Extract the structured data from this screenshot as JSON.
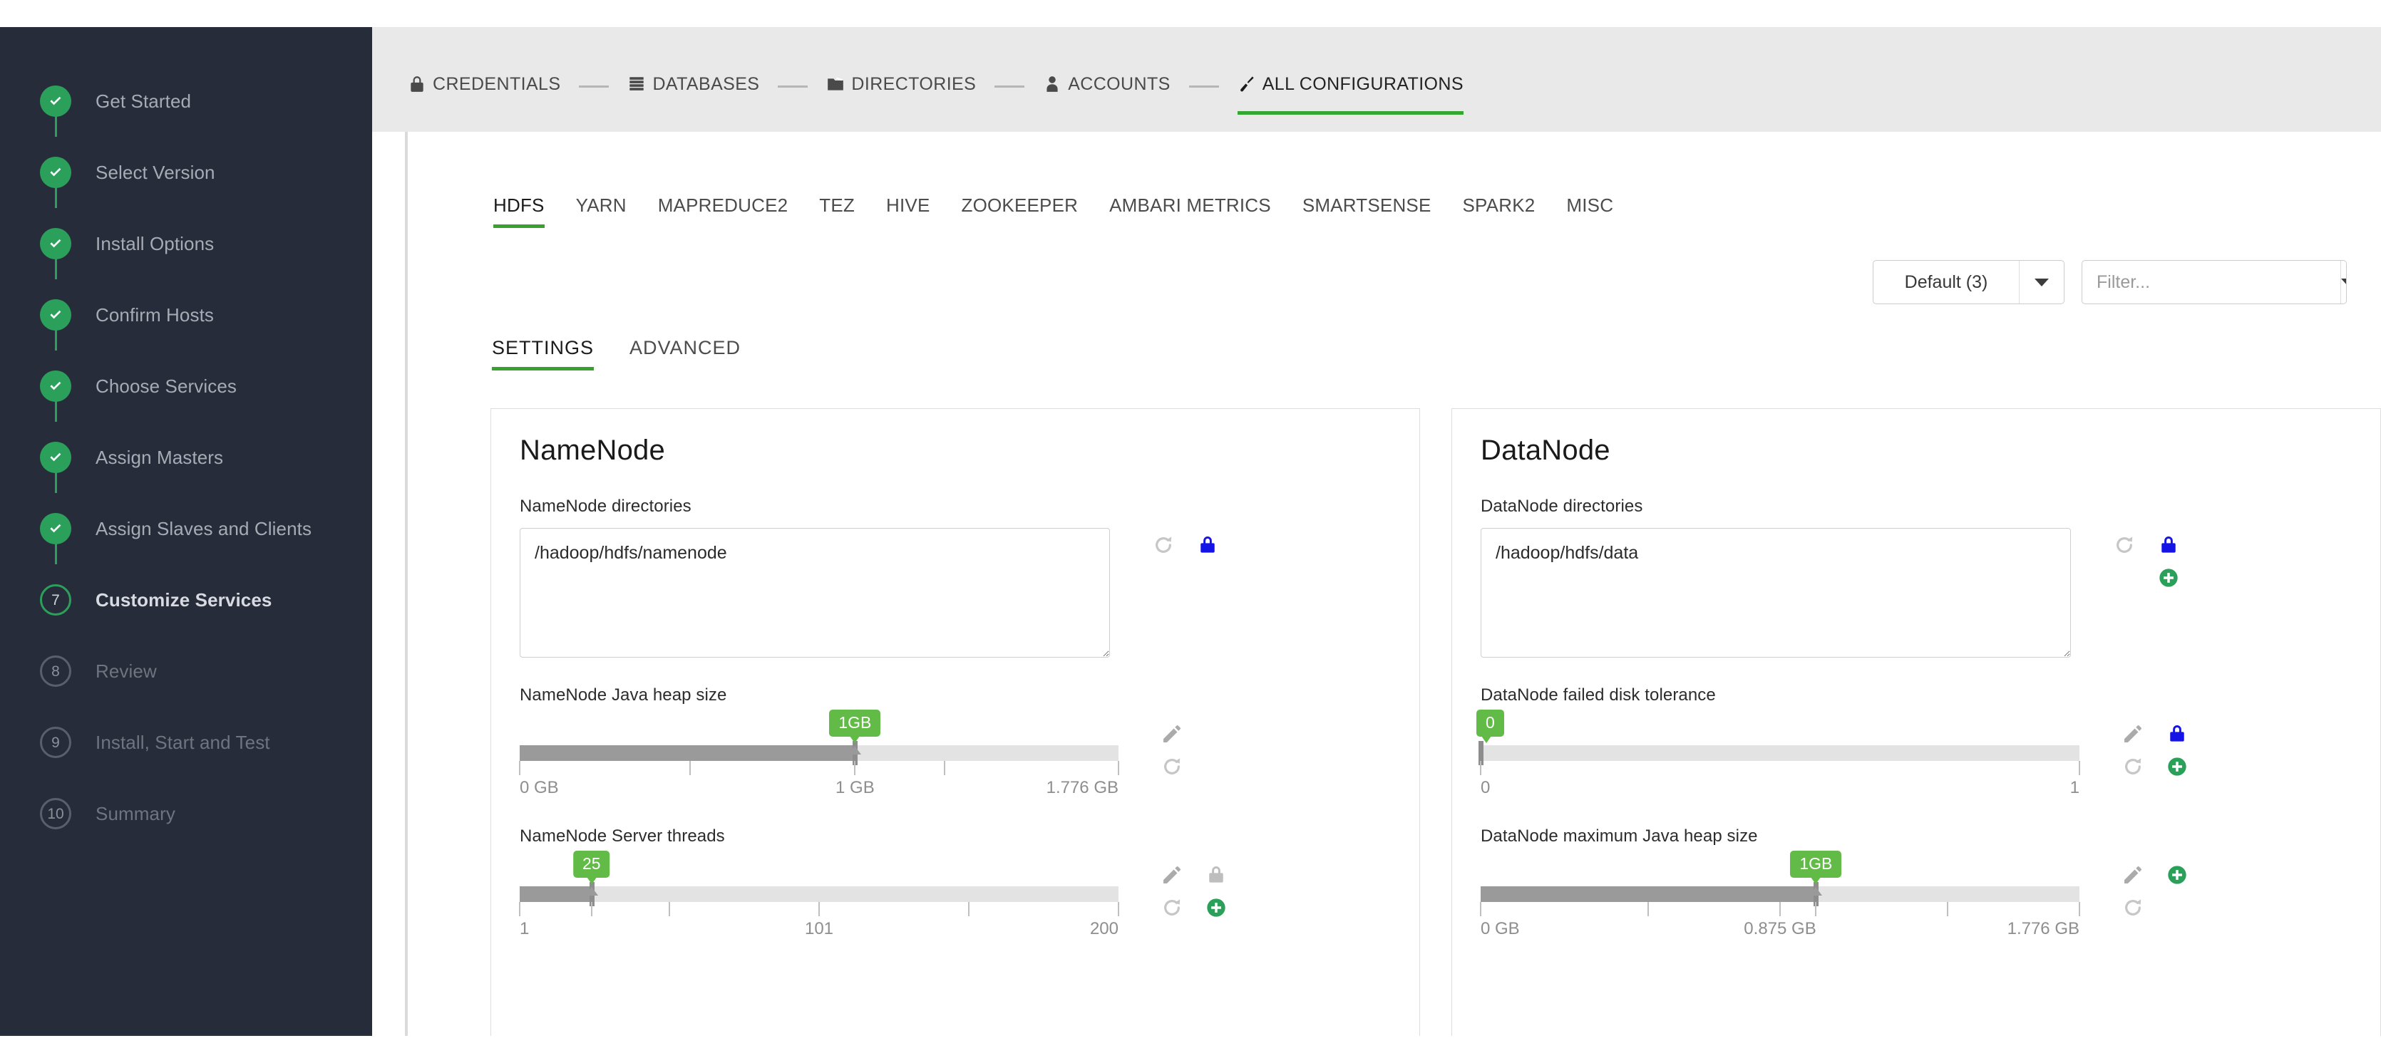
{
  "sidebar": {
    "steps": [
      {
        "label": "Get Started",
        "state": "done",
        "marker": "check"
      },
      {
        "label": "Select Version",
        "state": "done",
        "marker": "check"
      },
      {
        "label": "Install Options",
        "state": "done",
        "marker": "check"
      },
      {
        "label": "Confirm Hosts",
        "state": "done",
        "marker": "check"
      },
      {
        "label": "Choose Services",
        "state": "done",
        "marker": "check"
      },
      {
        "label": "Assign Masters",
        "state": "done",
        "marker": "check"
      },
      {
        "label": "Assign Slaves and Clients",
        "state": "done",
        "marker": "check"
      },
      {
        "label": "Customize Services",
        "state": "current",
        "marker": "7"
      },
      {
        "label": "Review",
        "state": "todo",
        "marker": "8"
      },
      {
        "label": "Install, Start and Test",
        "state": "todo",
        "marker": "9"
      },
      {
        "label": "Summary",
        "state": "todo",
        "marker": "10"
      }
    ]
  },
  "topnav": {
    "items": [
      {
        "label": "CREDENTIALS",
        "icon": "lock-icon",
        "active": false
      },
      {
        "label": "DATABASES",
        "icon": "database-icon",
        "active": false
      },
      {
        "label": "DIRECTORIES",
        "icon": "folder-icon",
        "active": false
      },
      {
        "label": "ACCOUNTS",
        "icon": "user-icon",
        "active": false
      },
      {
        "label": "ALL CONFIGURATIONS",
        "icon": "wrench-icon",
        "active": true
      }
    ]
  },
  "service_tabs": [
    {
      "label": "HDFS",
      "active": true
    },
    {
      "label": "YARN",
      "active": false
    },
    {
      "label": "MAPREDUCE2",
      "active": false
    },
    {
      "label": "TEZ",
      "active": false
    },
    {
      "label": "HIVE",
      "active": false
    },
    {
      "label": "ZOOKEEPER",
      "active": false
    },
    {
      "label": "AMBARI METRICS",
      "active": false
    },
    {
      "label": "SMARTSENSE",
      "active": false
    },
    {
      "label": "SPARK2",
      "active": false
    },
    {
      "label": "MISC",
      "active": false
    }
  ],
  "toolbar": {
    "config_group_label": "Default (3)",
    "filter_placeholder": "Filter...",
    "filter_value": ""
  },
  "settings_tabs": [
    {
      "label": "SETTINGS",
      "active": true
    },
    {
      "label": "ADVANCED",
      "active": false
    }
  ],
  "panels": [
    {
      "title": "NameNode",
      "properties": [
        {
          "label": "NameNode directories",
          "type": "textarea",
          "value": "/hadoop/hdfs/namenode",
          "actions": [
            "undo-icon",
            "lock-blue-icon"
          ]
        },
        {
          "label": "NameNode Java heap size",
          "type": "slider",
          "badge": "1GB",
          "fill_percent": 56,
          "ticks_percent": [
            0,
            28.5,
            56,
            71,
            100
          ],
          "labels": [
            {
              "text": "0 GB",
              "percent": 0,
              "align": "start"
            },
            {
              "text": "1 GB",
              "percent": 56,
              "align": "mid"
            },
            {
              "text": "1.776 GB",
              "percent": 100,
              "align": "end"
            }
          ],
          "actions": [
            "edit-icon",
            "undo-icon"
          ]
        },
        {
          "label": "NameNode Server threads",
          "type": "slider",
          "badge": "25",
          "fill_percent": 12,
          "ticks_percent": [
            0,
            12,
            25,
            50,
            75,
            100
          ],
          "labels": [
            {
              "text": "1",
              "percent": 0,
              "align": "start"
            },
            {
              "text": "101",
              "percent": 50,
              "align": "mid"
            },
            {
              "text": "200",
              "percent": 100,
              "align": "end"
            }
          ],
          "actions": [
            "edit-icon",
            "undo-icon",
            "lock-gray-icon",
            "plus-green-icon"
          ]
        }
      ]
    },
    {
      "title": "DataNode",
      "properties": [
        {
          "label": "DataNode directories",
          "type": "textarea",
          "value": "/hadoop/hdfs/data",
          "actions": [
            "undo-icon",
            "lock-blue-icon",
            "plus-green-icon"
          ]
        },
        {
          "label": "DataNode failed disk tolerance",
          "type": "slider",
          "badge": "0",
          "fill_percent": 0,
          "ticks_percent": [
            0,
            100
          ],
          "labels": [
            {
              "text": "0",
              "percent": 0,
              "align": "start"
            },
            {
              "text": "1",
              "percent": 100,
              "align": "end"
            }
          ],
          "actions": [
            "edit-icon",
            "undo-icon",
            "lock-blue-icon",
            "plus-green-icon"
          ]
        },
        {
          "label": "DataNode maximum Java heap size",
          "type": "slider",
          "badge": "1GB",
          "fill_percent": 56,
          "ticks_percent": [
            0,
            28,
            50,
            56,
            78,
            100
          ],
          "labels": [
            {
              "text": "0 GB",
              "percent": 0,
              "align": "start"
            },
            {
              "text": "0.875 GB",
              "percent": 50,
              "align": "mid"
            },
            {
              "text": "1.776 GB",
              "percent": 100,
              "align": "end"
            }
          ],
          "actions": [
            "edit-icon",
            "undo-icon",
            "plus-green-icon"
          ]
        }
      ]
    }
  ],
  "colors": {
    "accent_green": "#36A632",
    "badge_green": "#62BB46",
    "step_green": "#2BA05B",
    "lock_blue": "#1414E6",
    "plus_green": "#2BA05B",
    "sidebar_bg": "#272C3A",
    "header_bg": "#E9E9E9"
  }
}
